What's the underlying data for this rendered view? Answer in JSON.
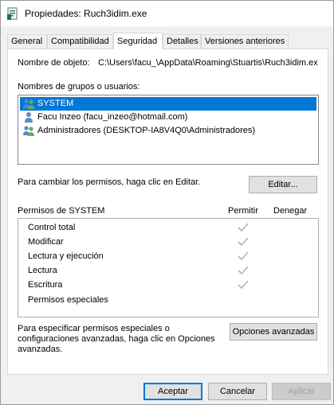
{
  "window": {
    "title": "Propiedades: Ruch3idim.exe"
  },
  "tabs": [
    {
      "label": "General"
    },
    {
      "label": "Compatibilidad"
    },
    {
      "label": "Seguridad"
    },
    {
      "label": "Detalles"
    },
    {
      "label": "Versiones anteriores"
    }
  ],
  "object": {
    "label": "Nombre de objeto:",
    "value": "C:\\Users\\facu_\\AppData\\Roaming\\Stuartis\\Ruch3idim.ex"
  },
  "groups": {
    "label": "Nombres de grupos o usuarios:",
    "items": [
      {
        "name": "SYSTEM",
        "icon": "group-users-icon",
        "selected": true
      },
      {
        "name": "Facu Inzeo (facu_inzeo@hotmail.com)",
        "icon": "user-icon",
        "selected": false
      },
      {
        "name": "Administradores (DESKTOP-IA8V4Q0\\Administradores)",
        "icon": "group-users-icon",
        "selected": false
      }
    ]
  },
  "edit": {
    "hint": "Para cambiar los permisos, haga clic en Editar.",
    "button": "Editar..."
  },
  "permissions": {
    "label": "Permisos de SYSTEM",
    "allow_header": "Permitir",
    "deny_header": "Denegar",
    "rows": [
      {
        "name": "Control total",
        "allow": true
      },
      {
        "name": "Modificar",
        "allow": true
      },
      {
        "name": "Lectura y ejecución",
        "allow": true
      },
      {
        "name": "Lectura",
        "allow": true
      },
      {
        "name": "Escritura",
        "allow": true
      },
      {
        "name": "Permisos especiales",
        "allow": false
      }
    ]
  },
  "advanced": {
    "hint_line1": "Para especificar permisos especiales o",
    "hint_line2": "configuraciones avanzadas, haga clic en Opciones",
    "hint_line3": "avanzadas.",
    "button": "Opciones avanzadas"
  },
  "footer": {
    "ok": "Aceptar",
    "cancel": "Cancelar",
    "apply": "Aplicar"
  },
  "colors": {
    "selection": "#0078d7",
    "check": "#b4b4b4"
  }
}
